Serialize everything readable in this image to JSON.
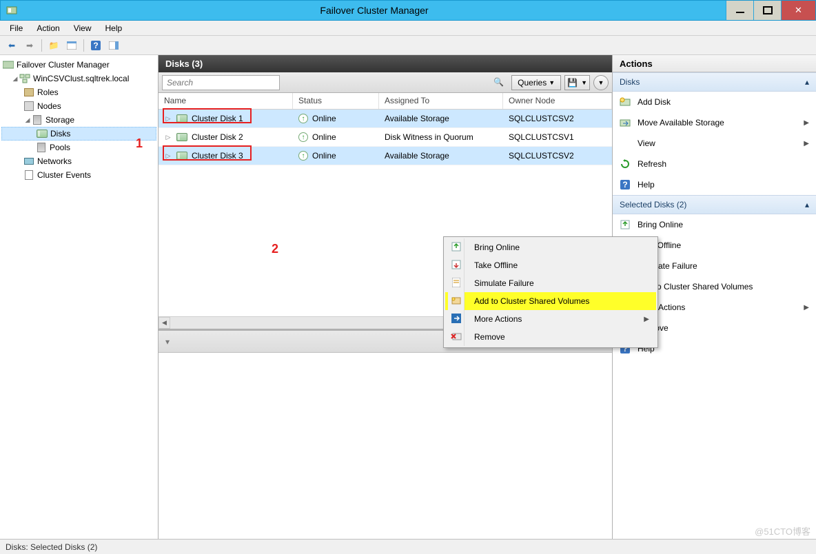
{
  "window": {
    "title": "Failover Cluster Manager"
  },
  "menubar": {
    "file": "File",
    "action": "Action",
    "view": "View",
    "help": "Help"
  },
  "tree": {
    "root": "Failover Cluster Manager",
    "cluster": "WinCSVClust.sqltrek.local",
    "roles": "Roles",
    "nodes": "Nodes",
    "storage": "Storage",
    "disks": "Disks",
    "pools": "Pools",
    "networks": "Networks",
    "events": "Cluster Events"
  },
  "center": {
    "header": "Disks (3)",
    "search_placeholder": "Search",
    "queries_label": "Queries",
    "cols": {
      "name": "Name",
      "status": "Status",
      "assigned": "Assigned To",
      "owner": "Owner Node"
    },
    "rows": [
      {
        "name": "Cluster Disk 1",
        "status": "Online",
        "assigned": "Available Storage",
        "owner": "SQLCLUSTCSV2"
      },
      {
        "name": "Cluster Disk 2",
        "status": "Online",
        "assigned": "Disk Witness in Quorum",
        "owner": "SQLCLUSTCSV1"
      },
      {
        "name": "Cluster Disk 3",
        "status": "Online",
        "assigned": "Available Storage",
        "owner": "SQLCLUSTCSV2"
      }
    ]
  },
  "annot": {
    "one": "1",
    "two": "2"
  },
  "context_menu": {
    "bring_online": "Bring Online",
    "take_offline": "Take Offline",
    "simulate_failure": "Simulate Failure",
    "add_csv": "Add to Cluster Shared Volumes",
    "more_actions": "More Actions",
    "remove": "Remove"
  },
  "actions": {
    "panel_title": "Actions",
    "group_disks": "Disks",
    "add_disk": "Add Disk",
    "move_storage": "Move Available Storage",
    "view": "View",
    "refresh": "Refresh",
    "help": "Help",
    "group_selected": "Selected Disks (2)",
    "bring_online": "Bring Online",
    "take_offline": "Take Offline",
    "simulate_failure": "Simulate Failure",
    "add_csv": "Add to Cluster Shared Volumes",
    "more_actions": "More Actions",
    "remove": "Remove",
    "help2": "Help"
  },
  "statusbar": {
    "text": "Disks:  Selected Disks (2)"
  },
  "watermark": "@51CTO博客"
}
